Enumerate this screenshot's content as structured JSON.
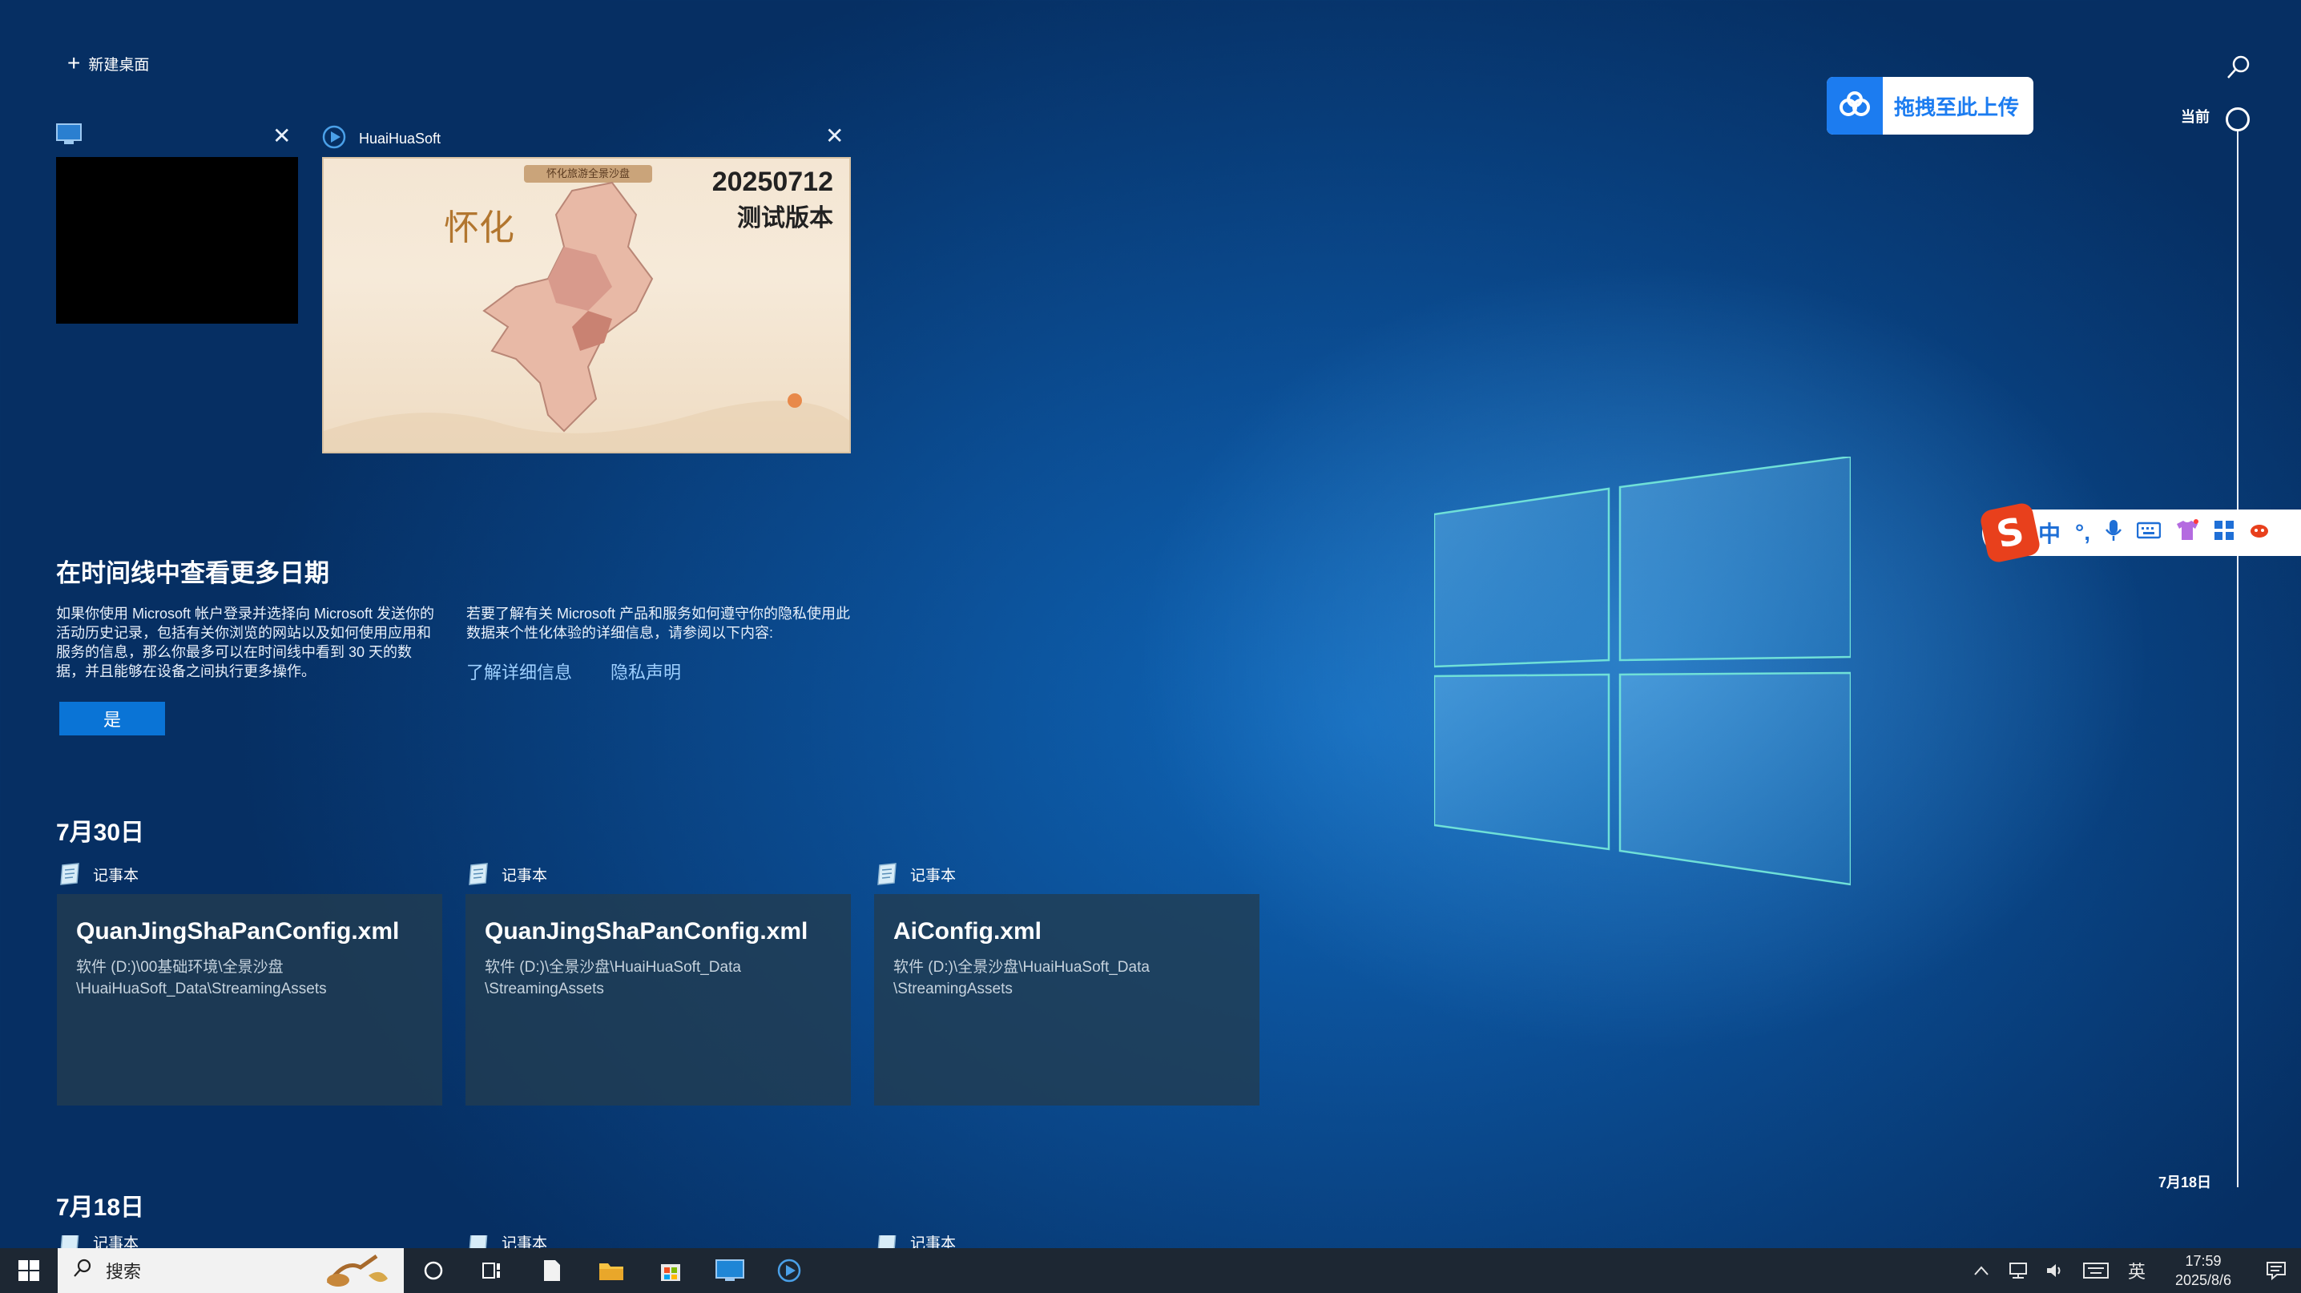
{
  "top": {
    "new_desktop_label": "新建桌面"
  },
  "windows": [
    {
      "title": "",
      "close": "✕"
    },
    {
      "title": "HuaiHuaSoft",
      "close": "✕",
      "preview": {
        "banner": "怀化旅游全景沙盘",
        "calligraphy": "怀化",
        "version_line1": "20250712",
        "version_line2": "测试版本"
      }
    }
  ],
  "timeline_info": {
    "title": "在时间线中查看更多日期",
    "left_text": "如果你使用 Microsoft 帐户登录并选择向 Microsoft 发送你的活动历史记录，包括有关你浏览的网站以及如何使用应用和服务的信息，那么你最多可以在时间线中看到 30 天的数据，并且能够在设备之间执行更多操作。",
    "right_text": "若要了解有关 Microsoft 产品和服务如何遵守你的隐私使用此数据来个性化体验的详细信息，请参阅以下内容:",
    "link_learn_more": "了解详细信息",
    "link_privacy": "隐私声明",
    "yes_button": "是"
  },
  "groups": [
    {
      "date": "7月30日",
      "cards": [
        {
          "app": "记事本",
          "title": "QuanJingShaPanConfig.xml",
          "path_line1": "软件 (D:)\\00基础环境\\全景沙盘",
          "path_line2": "\\HuaiHuaSoft_Data\\StreamingAssets"
        },
        {
          "app": "记事本",
          "title": "QuanJingShaPanConfig.xml",
          "path_line1": "软件 (D:)\\全景沙盘\\HuaiHuaSoft_Data",
          "path_line2": "\\StreamingAssets"
        },
        {
          "app": "记事本",
          "title": "AiConfig.xml",
          "path_line1": "软件 (D:)\\全景沙盘\\HuaiHuaSoft_Data",
          "path_line2": "\\StreamingAssets"
        }
      ]
    },
    {
      "date": "7月18日",
      "cards": [
        {
          "app": "记事本"
        },
        {
          "app": "记事本"
        },
        {
          "app": "记事本"
        }
      ]
    }
  ],
  "timeline_scrubber": {
    "current_label": "当前",
    "bottom_label": "7月18日"
  },
  "baidu": {
    "label": "拖拽至此上传",
    "color": "#1c7cf0"
  },
  "ime": {
    "mode": "中",
    "punct": "°,",
    "color": "#1f6fd6"
  },
  "taskbar": {
    "search_placeholder": "搜索",
    "icons": [
      "windows-start-icon",
      "cortana-icon",
      "task-view-icon",
      "notepad-icon",
      "file-explorer-icon",
      "store-icon",
      "monitor-app-icon",
      "huaihuasoft-icon"
    ],
    "tray": {
      "lang": "英",
      "time": "17:59",
      "date": "2025/8/6"
    },
    "background": "#1d2733"
  }
}
